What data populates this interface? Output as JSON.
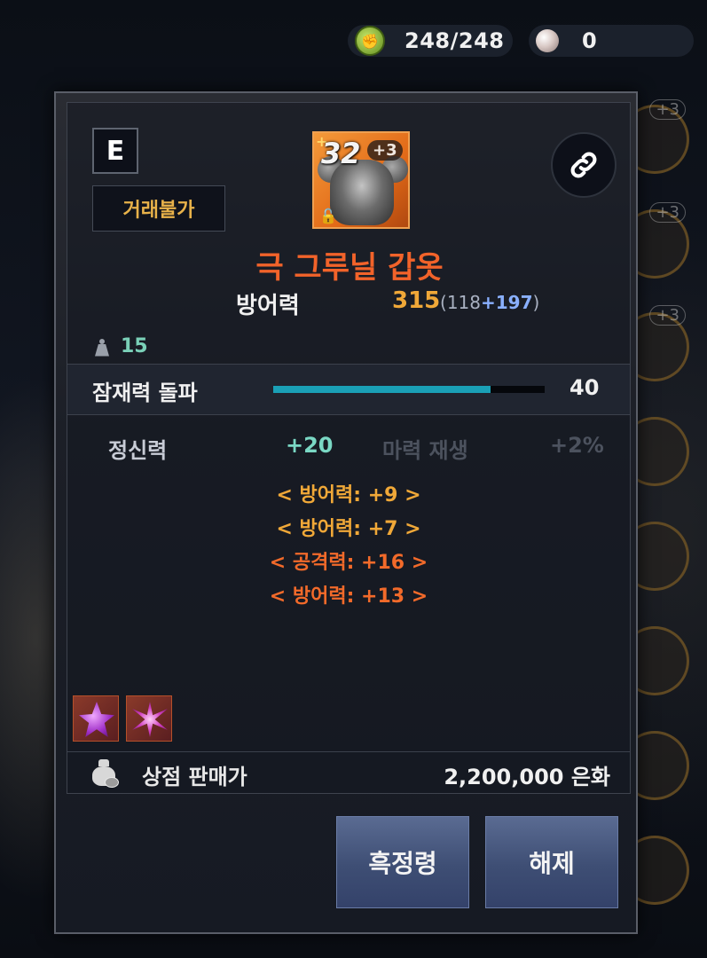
{
  "currency": {
    "energy_icon": "energy-icon",
    "energy_value": "248/248",
    "pearl_icon": "pearl-icon",
    "pearl_value": "0"
  },
  "background": {
    "slot_badges": [
      "+3",
      "+3",
      "+3"
    ]
  },
  "item": {
    "grade": "E",
    "trade_status": "거래불가",
    "enhance_level": "32",
    "enhance_bonus": "+3",
    "name": "극 그루닐 갑옷",
    "defense_label": "방어력",
    "defense_value": "315",
    "defense_base": "118",
    "defense_plus": "+197",
    "weight": "15",
    "potential_label": "잠재력 돌파",
    "potential_value": "40",
    "potential_fraction": 0.8,
    "stat1_name": "정신력",
    "stat1_value": "+20",
    "stat2_name": "마력 재생",
    "stat2_value": "+2%",
    "bonuses": [
      {
        "text": "< 방어력: +9 >",
        "color": "#f0a838"
      },
      {
        "text": "< 방어력: +7 >",
        "color": "#f0a838"
      },
      {
        "text": "< 공격력: +16 >",
        "color": "#f26a2a"
      },
      {
        "text": "< 방어력: +13 >",
        "color": "#f26a2a"
      }
    ],
    "sell_label": "상점 판매가",
    "sell_value": "2,200,000 은화"
  },
  "buttons": {
    "blackstone": "흑정령",
    "release": "해제"
  },
  "colors": {
    "item_name": "#f2632a",
    "potential_fill": "#1aa0b6",
    "button_bg": "#3e4e74"
  }
}
